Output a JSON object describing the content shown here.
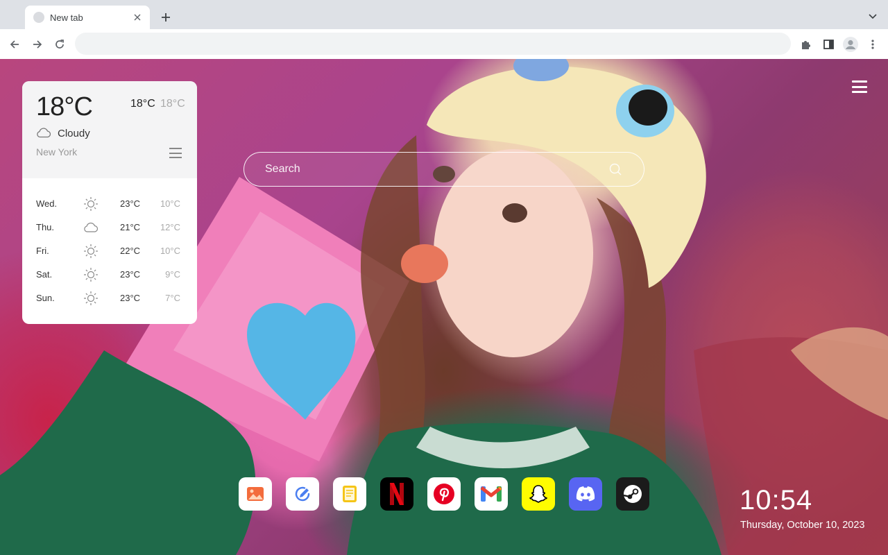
{
  "browser": {
    "tab": {
      "title": "New tab",
      "close": "✕"
    },
    "new_tab": "+",
    "omnibox": {
      "value": "",
      "placeholder": ""
    }
  },
  "weather": {
    "current_temp": "18°C",
    "high": "18°C",
    "low": "18°C",
    "condition": "Cloudy",
    "condition_icon": "cloud-icon",
    "city": "New York",
    "forecast": [
      {
        "day": "Wed.",
        "icon": "sun-icon",
        "high": "23°C",
        "low": "10°C"
      },
      {
        "day": "Thu.",
        "icon": "cloud-icon",
        "high": "21°C",
        "low": "12°C"
      },
      {
        "day": "Fri.",
        "icon": "sun-icon",
        "high": "22°C",
        "low": "10°C"
      },
      {
        "day": "Sat.",
        "icon": "sun-icon",
        "high": "23°C",
        "low": "9°C"
      },
      {
        "day": "Sun.",
        "icon": "sun-icon",
        "high": "23°C",
        "low": "7°C"
      }
    ]
  },
  "search": {
    "placeholder": "Search"
  },
  "dock": [
    {
      "name": "photos-app",
      "icon": "photos-icon",
      "color": "#f36c3c"
    },
    {
      "name": "tasks-app",
      "icon": "check-pencil-icon",
      "color": "#4a7ef0"
    },
    {
      "name": "notes-app",
      "icon": "notes-icon",
      "color": "#f5c518"
    },
    {
      "name": "netflix",
      "icon": "netflix-icon",
      "color": "#e50914"
    },
    {
      "name": "pinterest",
      "icon": "pinterest-icon",
      "color": "#e60023"
    },
    {
      "name": "gmail",
      "icon": "gmail-icon",
      "color": "#ea4335"
    },
    {
      "name": "snapchat",
      "icon": "snapchat-icon",
      "color": "#fffc00"
    },
    {
      "name": "discord",
      "icon": "discord-icon",
      "color": "#5865f2"
    },
    {
      "name": "steam",
      "icon": "steam-icon",
      "color": "#1b1b1b"
    }
  ],
  "clock": {
    "time": "10:54",
    "date": "Thursday, October 10, 2023"
  }
}
